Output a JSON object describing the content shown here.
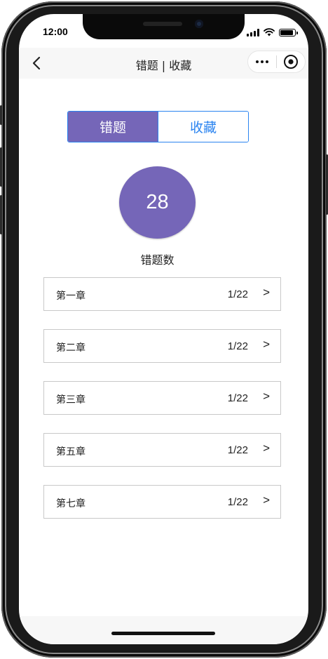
{
  "status": {
    "time": "12:00",
    "battery_level": 0.9
  },
  "nav": {
    "title": "错题 | 收藏",
    "back_icon": "chevron-left-icon",
    "more_icon": "more-dots-icon",
    "close_icon": "target-circle-icon"
  },
  "tabs": [
    {
      "label": "错题",
      "active": true
    },
    {
      "label": "收藏",
      "active": false
    }
  ],
  "summary": {
    "count": "28",
    "label": "错题数"
  },
  "chapters": [
    {
      "name": "第一章",
      "count": "1/22",
      "arrow": ">"
    },
    {
      "name": "第二章",
      "count": "1/22",
      "arrow": ">"
    },
    {
      "name": "第三章",
      "count": "1/22",
      "arrow": ">"
    },
    {
      "name": "第五章",
      "count": "1/22",
      "arrow": ">"
    },
    {
      "name": "第七章",
      "count": "1/22",
      "arrow": ">"
    }
  ],
  "colors": {
    "accent": "#7566b8",
    "tab_border": "#2b84f0",
    "nav_bg": "#f7f7f7"
  }
}
